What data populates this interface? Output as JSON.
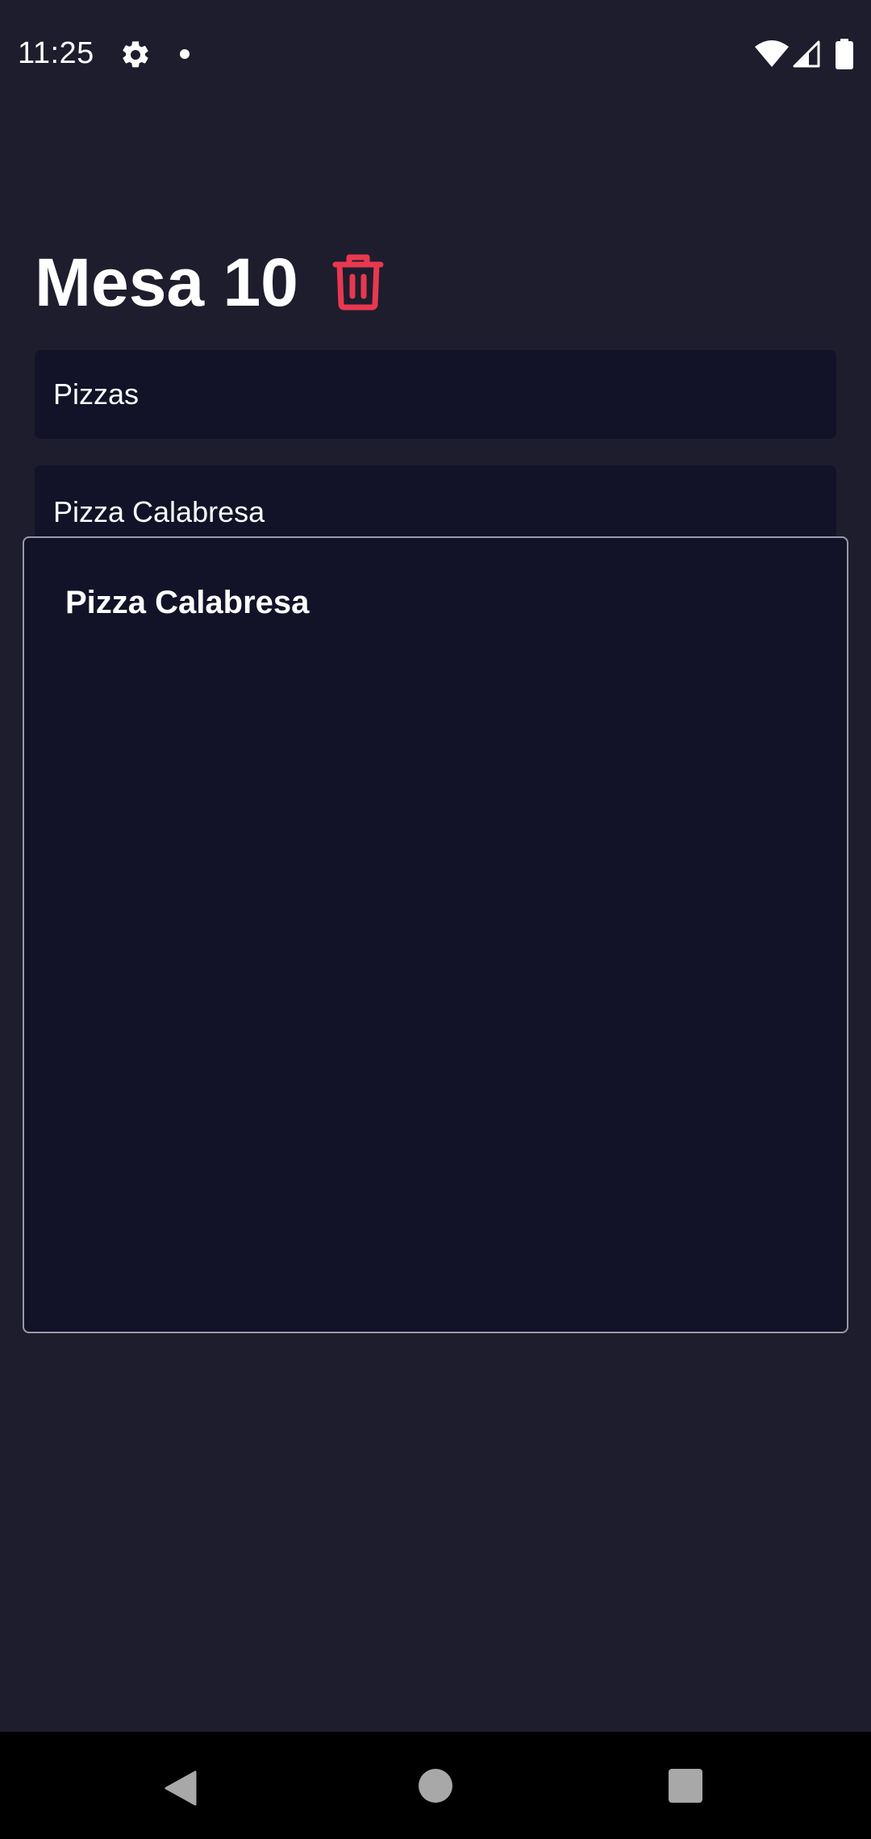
{
  "status_bar": {
    "time": "11:25",
    "icons": [
      "gear-icon",
      "notification-dot-icon",
      "wifi-icon",
      "signal-icon",
      "battery-icon"
    ]
  },
  "header": {
    "title": "Mesa 10",
    "delete_icon": "trash-icon",
    "delete_color": "#e8384f"
  },
  "form": {
    "category_value": "Pizzas",
    "product_value": "Pizza Calabresa"
  },
  "dropdown_panel": {
    "title": "Pizza Calabresa"
  },
  "nav_bar": {
    "icons": [
      "back-icon",
      "home-icon",
      "recents-icon"
    ]
  },
  "colors": {
    "background": "#1e1d2d",
    "field_background": "#121228",
    "accent_delete": "#e8384f",
    "panel_border": "#9a99a6"
  }
}
